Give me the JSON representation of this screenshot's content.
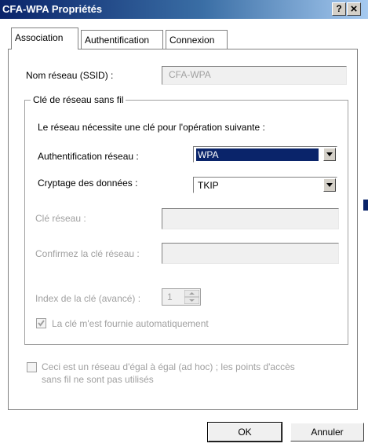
{
  "window": {
    "title": "CFA-WPA Propriétés",
    "help_glyph": "?",
    "close_glyph": "×"
  },
  "tabs": [
    {
      "label": "Association"
    },
    {
      "label": "Authentification"
    },
    {
      "label": "Connexion"
    }
  ],
  "network": {
    "ssid_label": "Nom réseau (SSID) :",
    "ssid_value": "CFA-WPA"
  },
  "key_group": {
    "title": "Clé de réseau sans fil",
    "description": "Le réseau nécessite une clé pour l'opération suivante :",
    "auth_label": "Authentification réseau :",
    "auth_value": "WPA",
    "crypt_label": "Cryptage des données :",
    "crypt_value": "TKIP",
    "net_key_label": "Clé réseau :",
    "confirm_key_label": "Confirmez la clé réseau :",
    "key_index_label": "Index de la clé (avancé) :",
    "key_index_value": "1",
    "auto_key_label": "La clé m'est fournie automatiquement",
    "auto_key_checked": true
  },
  "adhoc": {
    "line1": "Ceci est un réseau d'égal à égal (ad hoc) ; les points d'accès",
    "line2": "sans fil ne sont pas utilisés",
    "checked": false
  },
  "buttons": {
    "ok": "OK",
    "cancel": "Annuler"
  },
  "side_mark": "C",
  "colors": {
    "title_bar": "#0a246a",
    "selection": "#0a246a",
    "disabled_text": "#a0a0a0",
    "button_face": "#d4d0c8"
  }
}
